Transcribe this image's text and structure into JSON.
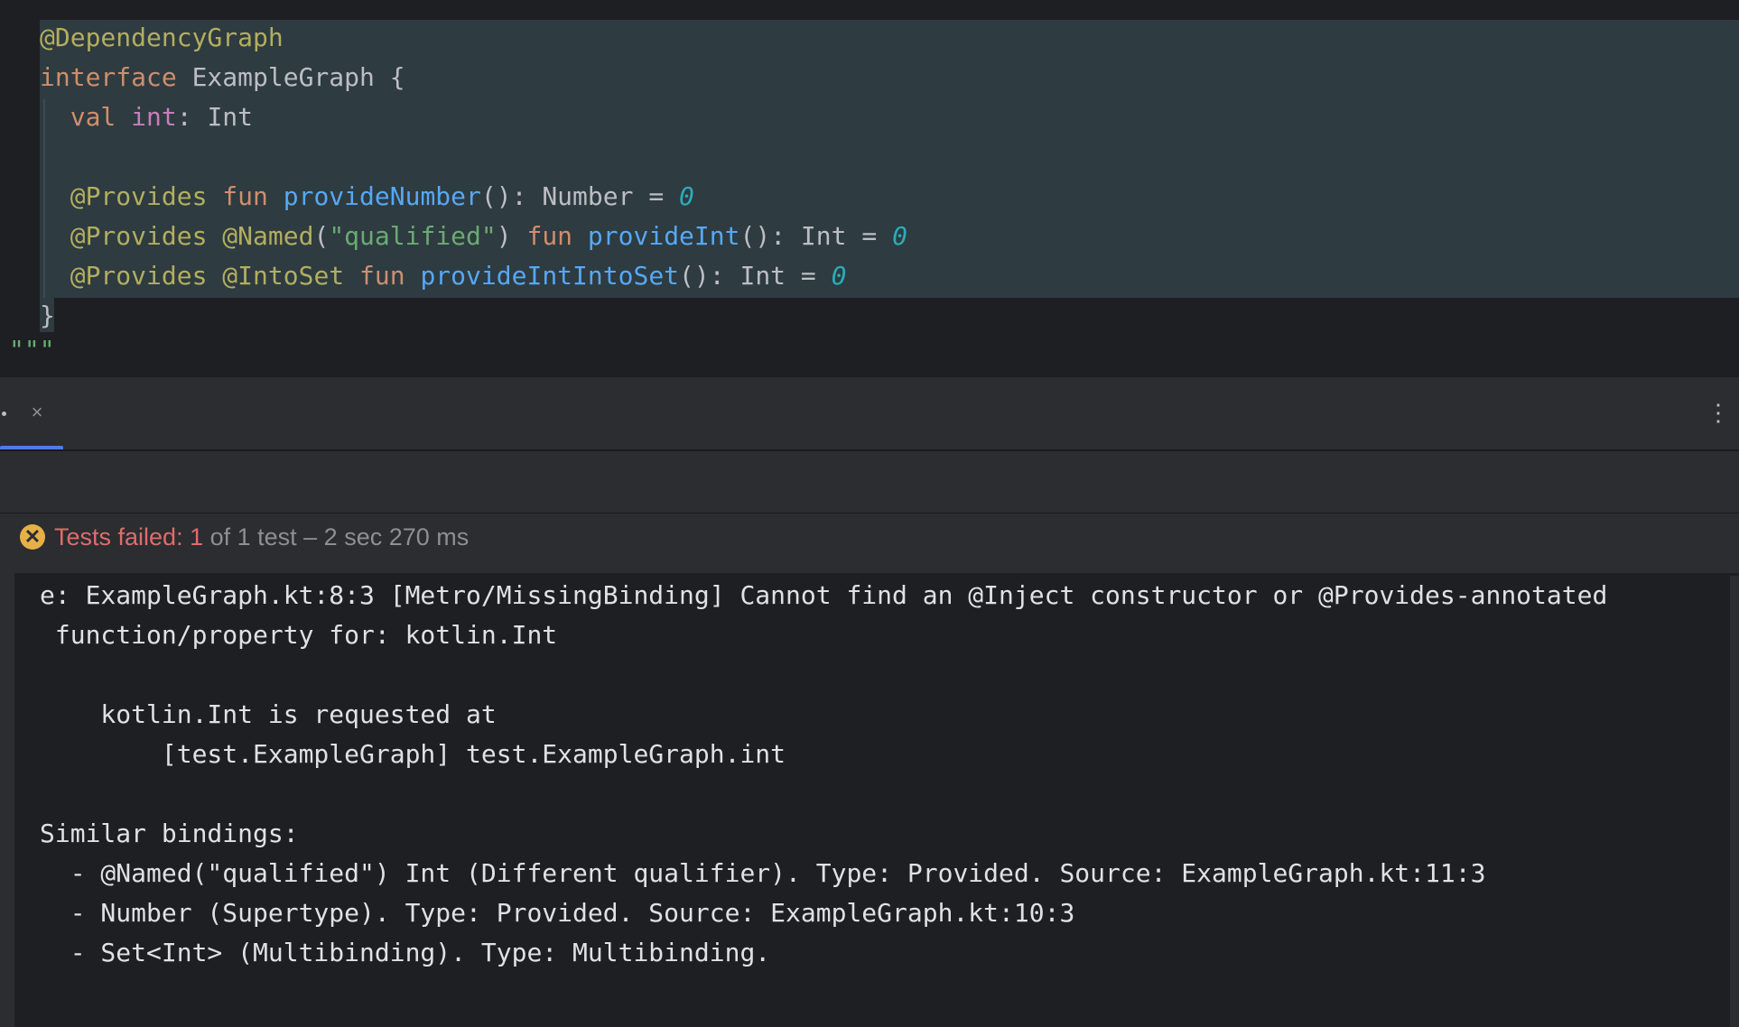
{
  "editor": {
    "lines": [
      [
        {
          "c": "a",
          "t": "@DependencyGraph"
        }
      ],
      [
        {
          "c": "k",
          "t": "interface"
        },
        {
          "c": "t",
          "t": " ExampleGraph {"
        }
      ],
      [
        {
          "c": "t",
          "t": "  "
        },
        {
          "c": "k",
          "t": "val"
        },
        {
          "c": "t",
          "t": " "
        },
        {
          "c": "p",
          "t": "int"
        },
        {
          "c": "t",
          "t": ": Int"
        }
      ],
      [
        {
          "c": "t",
          "t": ""
        }
      ],
      [
        {
          "c": "t",
          "t": "  "
        },
        {
          "c": "a",
          "t": "@Provides"
        },
        {
          "c": "t",
          "t": " "
        },
        {
          "c": "k",
          "t": "fun"
        },
        {
          "c": "t",
          "t": " "
        },
        {
          "c": "f",
          "t": "provideNumber"
        },
        {
          "c": "t",
          "t": "(): Number = "
        },
        {
          "c": "n",
          "t": "0"
        }
      ],
      [
        {
          "c": "t",
          "t": "  "
        },
        {
          "c": "a",
          "t": "@Provides"
        },
        {
          "c": "t",
          "t": " "
        },
        {
          "c": "a",
          "t": "@Named"
        },
        {
          "c": "t",
          "t": "("
        },
        {
          "c": "s",
          "t": "\"qualified\""
        },
        {
          "c": "t",
          "t": ") "
        },
        {
          "c": "k",
          "t": "fun"
        },
        {
          "c": "t",
          "t": " "
        },
        {
          "c": "f",
          "t": "provideInt"
        },
        {
          "c": "t",
          "t": "(): Int = "
        },
        {
          "c": "n",
          "t": "0"
        }
      ],
      [
        {
          "c": "t",
          "t": "  "
        },
        {
          "c": "a",
          "t": "@Provides"
        },
        {
          "c": "t",
          "t": " "
        },
        {
          "c": "a",
          "t": "@IntoSet"
        },
        {
          "c": "t",
          "t": " "
        },
        {
          "c": "k",
          "t": "fun"
        },
        {
          "c": "t",
          "t": " "
        },
        {
          "c": "f",
          "t": "provideIntIntoSet"
        },
        {
          "c": "t",
          "t": "(): Int = "
        },
        {
          "c": "n",
          "t": "0"
        }
      ],
      [
        {
          "c": "t",
          "t": "}"
        }
      ]
    ],
    "closing_quotes": "\"\"\""
  },
  "tab": {
    "close_icon": "×",
    "more_icon": "⋮"
  },
  "status": {
    "icon_glyph": "✕",
    "failed_label": "Tests failed: 1",
    "rest_label": " of 1 test – 2 sec 270 ms"
  },
  "console": {
    "lines": [
      "e: ExampleGraph.kt:8:3 [Metro/MissingBinding] Cannot find an @Inject constructor or @Provides-annotated",
      " function/property for: kotlin.Int",
      "",
      "    kotlin.Int is requested at",
      "        [test.ExampleGraph] test.ExampleGraph.int",
      "",
      "Similar bindings:",
      "  - @Named(\"qualified\") Int (Different qualifier). Type: Provided. Source: ExampleGraph.kt:11:3",
      "  - Number (Supertype). Type: Provided. Source: ExampleGraph.kt:10:3",
      "  - Set<Int> (Multibinding). Type: Multibinding."
    ]
  },
  "colors": {
    "editor_bg": "#1e1f22",
    "selection": "#2e3b40",
    "accent": "#4f7be8",
    "fail": "#e06c6c",
    "warning_icon": "#e5b046"
  }
}
